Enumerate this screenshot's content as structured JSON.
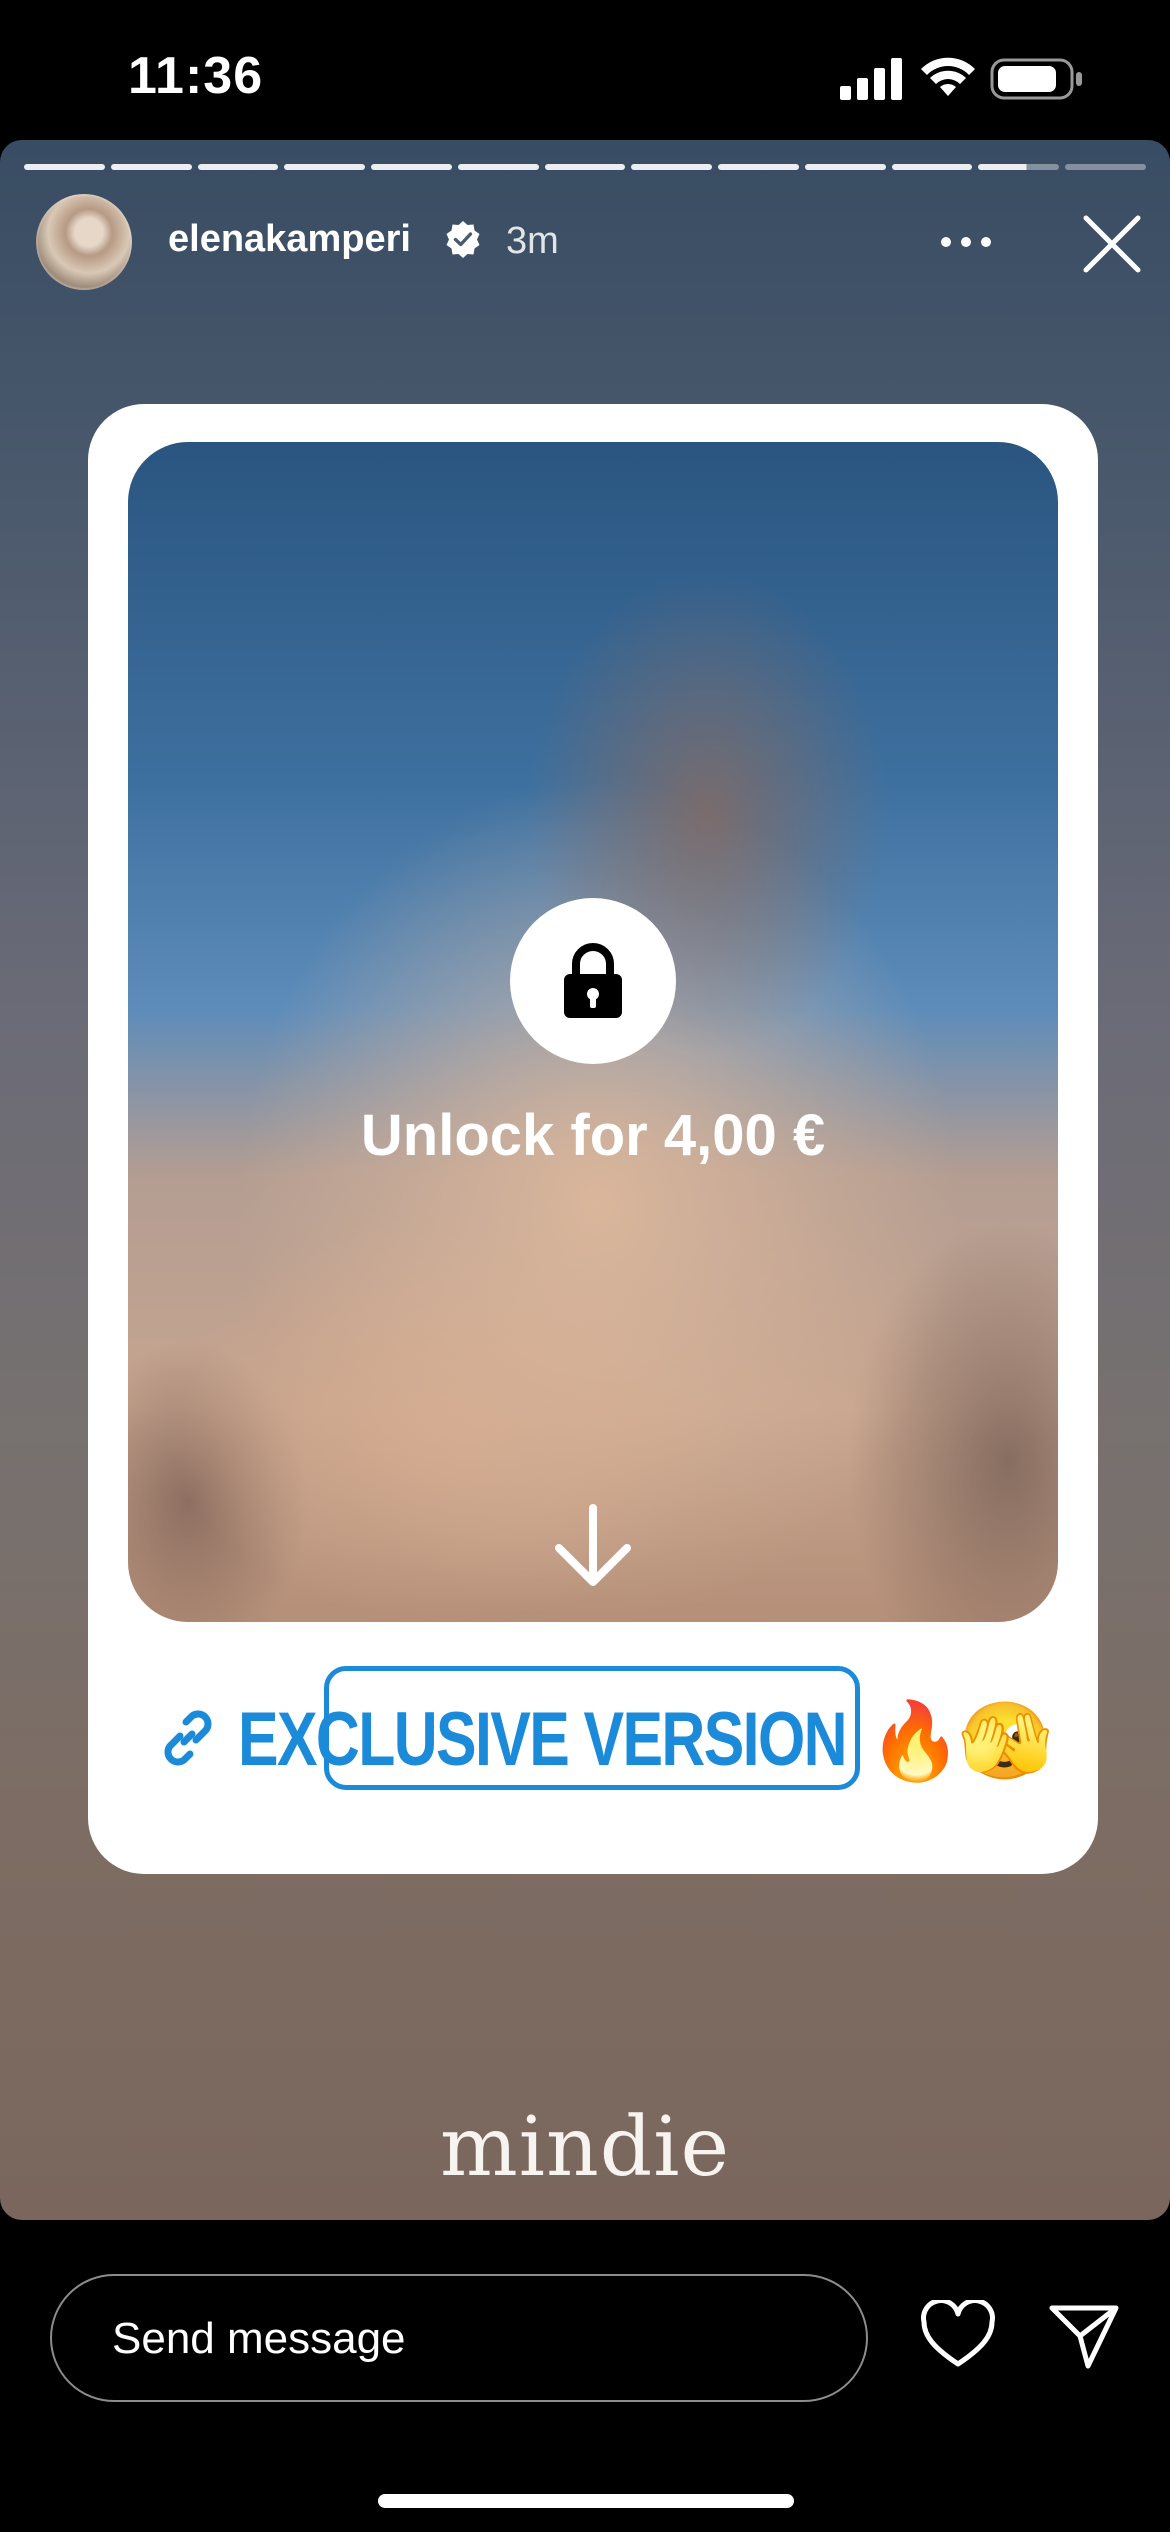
{
  "status_bar": {
    "time": "11:36"
  },
  "story": {
    "progress": {
      "segments": 13,
      "completed": 12,
      "current_fraction": 0.6
    },
    "header": {
      "username": "elenakamperi",
      "verified": true,
      "time_ago": "3m"
    },
    "card": {
      "unlock_label": "Unlock for 4,00 €",
      "sticker_text": "EXCLUSIVE VERSION",
      "emoji_1": "🔥",
      "emoji_2": "🫣"
    },
    "watermark": "mindie"
  },
  "bottom_bar": {
    "message_placeholder": "Send message"
  },
  "colors": {
    "link_blue": "#1a8ad9",
    "background": "#000000"
  },
  "icons": [
    "signal-icon",
    "wifi-icon",
    "battery-icon",
    "verified-icon",
    "more-icon",
    "close-icon",
    "lock-icon",
    "arrow-down-icon",
    "link-icon",
    "heart-icon",
    "send-icon"
  ]
}
